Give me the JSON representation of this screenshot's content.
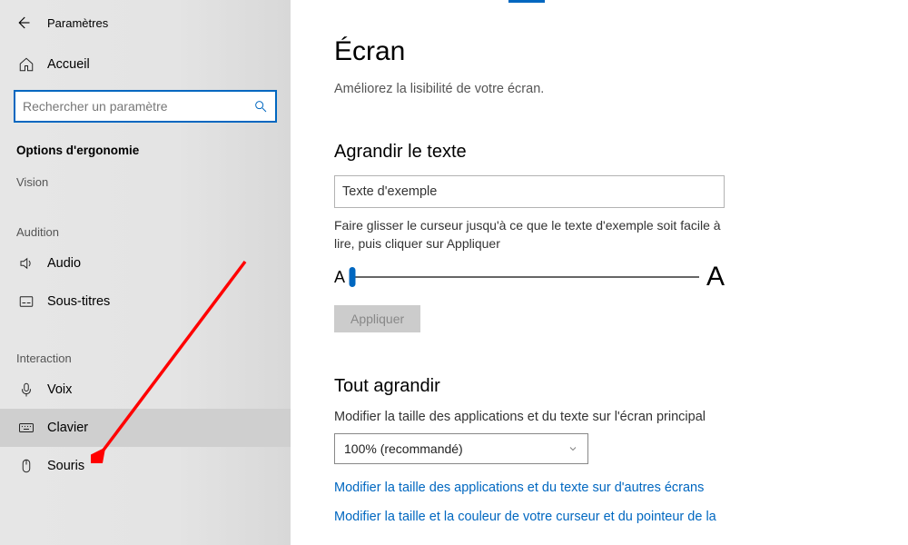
{
  "window_title": "Paramètres",
  "home_label": "Accueil",
  "search": {
    "placeholder": "Rechercher un paramètre"
  },
  "sidebar": {
    "section": "Options d'ergonomie",
    "groups": [
      {
        "header": "Vision",
        "items": []
      },
      {
        "header": "Audition",
        "items": [
          {
            "label": "Audio",
            "icon": "audio-icon"
          },
          {
            "label": "Sous-titres",
            "icon": "subtitles-icon"
          }
        ]
      },
      {
        "header": "Interaction",
        "items": [
          {
            "label": "Voix",
            "icon": "voice-icon"
          },
          {
            "label": "Clavier",
            "icon": "keyboard-icon",
            "selected": true
          },
          {
            "label": "Souris",
            "icon": "mouse-icon"
          }
        ]
      }
    ]
  },
  "main": {
    "title": "Écran",
    "subtitle": "Améliorez la lisibilité de votre écran.",
    "text_section": {
      "heading": "Agrandir le texte",
      "sample": "Texte d'exemple",
      "hint": "Faire glisser le curseur jusqu'à ce que le texte d'exemple soit facile à lire, puis cliquer sur Appliquer",
      "apply": "Appliquer"
    },
    "scale_section": {
      "heading": "Tout agrandir",
      "label": "Modifier la taille des applications et du texte sur l'écran principal",
      "selected": "100% (recommandé)",
      "link1": "Modifier la taille des applications et du texte sur d'autres écrans",
      "link2": "Modifier la taille et la couleur de votre curseur et du pointeur de la"
    }
  }
}
